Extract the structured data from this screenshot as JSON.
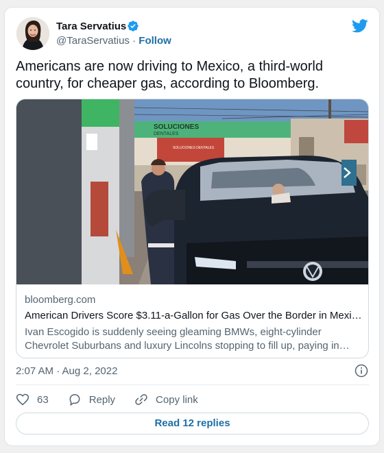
{
  "author": {
    "name": "Tara Servatius",
    "handle": "@TaraServatius",
    "separator": " · ",
    "follow_label": "Follow"
  },
  "tweet": {
    "text": "Americans are now driving to Mexico, a third-world country, for cheaper gas, according to Bloomberg."
  },
  "link_card": {
    "domain": "bloomberg.com",
    "title": "American Drivers Score $3.11-a-Gallon for Gas Over the Border in Mexico",
    "description": "Ivan Escogido is suddenly seeing gleaming BMWs, eight-cylinder Chevrolet Suburbans and luxury Lincolns stopping to fill up, paying in pesos at the pump.",
    "photo_sign_text": "SOLUCIONES",
    "photo_sign_subtext": "DENTALES",
    "photo_small_sign": "SOLUCIONES DENTALES"
  },
  "timestamp": "2:07 AM · Aug 2, 2022",
  "actions": {
    "like_count": "63",
    "reply_label": "Reply",
    "copy_link_label": "Copy link"
  },
  "read_replies_label": "Read 12 replies",
  "colors": {
    "link_blue": "#1d6fa5",
    "twitter_blue": "#1d9bf0",
    "secondary_text": "#536471",
    "border": "#cfd9de"
  },
  "icons": [
    "verified-badge-icon",
    "twitter-bird-icon",
    "info-icon",
    "heart-icon",
    "reply-icon",
    "link-icon"
  ]
}
